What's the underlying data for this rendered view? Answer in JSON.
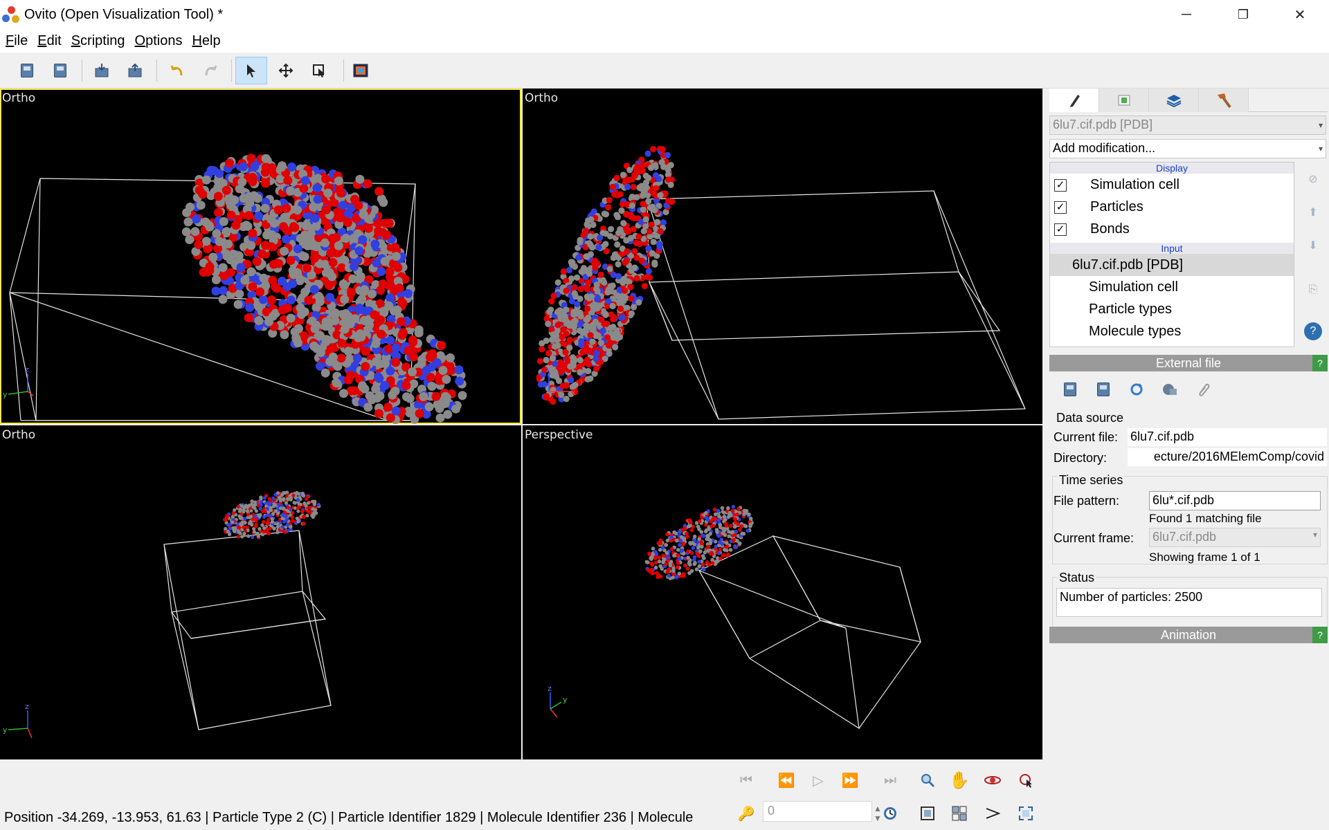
{
  "window": {
    "title": "Ovito (Open Visualization Tool) *",
    "minimize_glyph": "─",
    "restore_glyph": "❐",
    "close_glyph": "✕"
  },
  "menu": {
    "items": [
      {
        "label": "File",
        "accel": "F",
        "rest": "ile"
      },
      {
        "label": "Edit",
        "accel": "E",
        "rest": "dit"
      },
      {
        "label": "Scripting",
        "accel": "S",
        "rest": "cripting"
      },
      {
        "label": "Options",
        "accel": "O",
        "rest": "ptions"
      },
      {
        "label": "Help",
        "accel": "H",
        "rest": "elp"
      }
    ]
  },
  "toolbar": {
    "icons": [
      "load-file-icon",
      "save-session-icon",
      "import-icon",
      "export-icon",
      "undo-icon",
      "redo-icon",
      "selection-mode-icon",
      "move-mode-icon",
      "pick-mode-icon",
      "render-icon"
    ],
    "active": "selection-mode-icon"
  },
  "viewports": [
    {
      "caption": "Ortho",
      "active": true
    },
    {
      "caption": "Ortho",
      "active": false
    },
    {
      "caption": "Ortho",
      "active": false
    },
    {
      "caption": "Perspective",
      "active": false
    }
  ],
  "colors": {
    "viewport_bg": "#000000",
    "active_border": "#f2e64a",
    "atom_grey": "#8a8a8a",
    "atom_red": "#e00000",
    "atom_blue": "#3040e0",
    "help_green": "#3f9b47",
    "rollout_grey": "#9a9a9a"
  },
  "panel": {
    "tabs": [
      "pencil-icon",
      "render-icon",
      "layers-icon",
      "hammer-icon"
    ],
    "pipeline_combo": "6lu7.cif.pdb [PDB]",
    "add_modification": "Add modification...",
    "pipeline": {
      "display_header": "Display",
      "display_items": [
        {
          "label": "Simulation cell",
          "checked": true
        },
        {
          "label": "Particles",
          "checked": true
        },
        {
          "label": "Bonds",
          "checked": true
        }
      ],
      "input_header": "Input",
      "input_source": "6lu7.cif.pdb [PDB]",
      "input_items": [
        "Simulation cell",
        "Particle types",
        "Molecule types"
      ]
    },
    "side_buttons": [
      "disable-icon",
      "move-up-icon",
      "move-down-icon",
      "make-independent-icon",
      "help-icon"
    ],
    "external_file": {
      "header": "External file",
      "help": "?",
      "tools": [
        "open-file-icon",
        "open-remote-icon",
        "reload-icon",
        "update-remote-icon",
        "attach-icon"
      ],
      "data_source_title": "Data source",
      "current_file_label": "Current file:",
      "current_file": "6lu7.cif.pdb",
      "directory_label": "Directory:",
      "directory": "ecture/2016MElemComp/covid",
      "time_series_title": "Time series",
      "file_pattern_label": "File pattern:",
      "file_pattern": "6lu*.cif.pdb",
      "found_text": "Found 1 matching file",
      "current_frame_label": "Current frame:",
      "current_frame": "6lu7.cif.pdb",
      "showing_frame": "Showing frame 1 of 1",
      "status_title": "Status",
      "status_text": "Number of particles: 2500"
    },
    "animation": {
      "header": "Animation",
      "help": "?"
    }
  },
  "animation_bar": {
    "playback_buttons": [
      "goto-start-icon",
      "prev-frame-icon",
      "play-icon",
      "next-frame-icon",
      "goto-end-icon"
    ],
    "nav_buttons": [
      "zoom-icon",
      "pan-icon",
      "orbit-icon",
      "pick-orbit-center-icon"
    ],
    "bottom_buttons": [
      "auto-key-icon",
      "animation-settings-icon",
      "zoom-all-icon",
      "zoom-all-viewports-icon",
      "fov-icon",
      "maximize-viewport-icon"
    ],
    "frame_value": "0"
  },
  "status": {
    "text": "Position -34.269, -13.953, 61.63 | Particle Type 2 (C) | Particle Identifier 1829 | Molecule Identifier 236 | Molecule"
  }
}
